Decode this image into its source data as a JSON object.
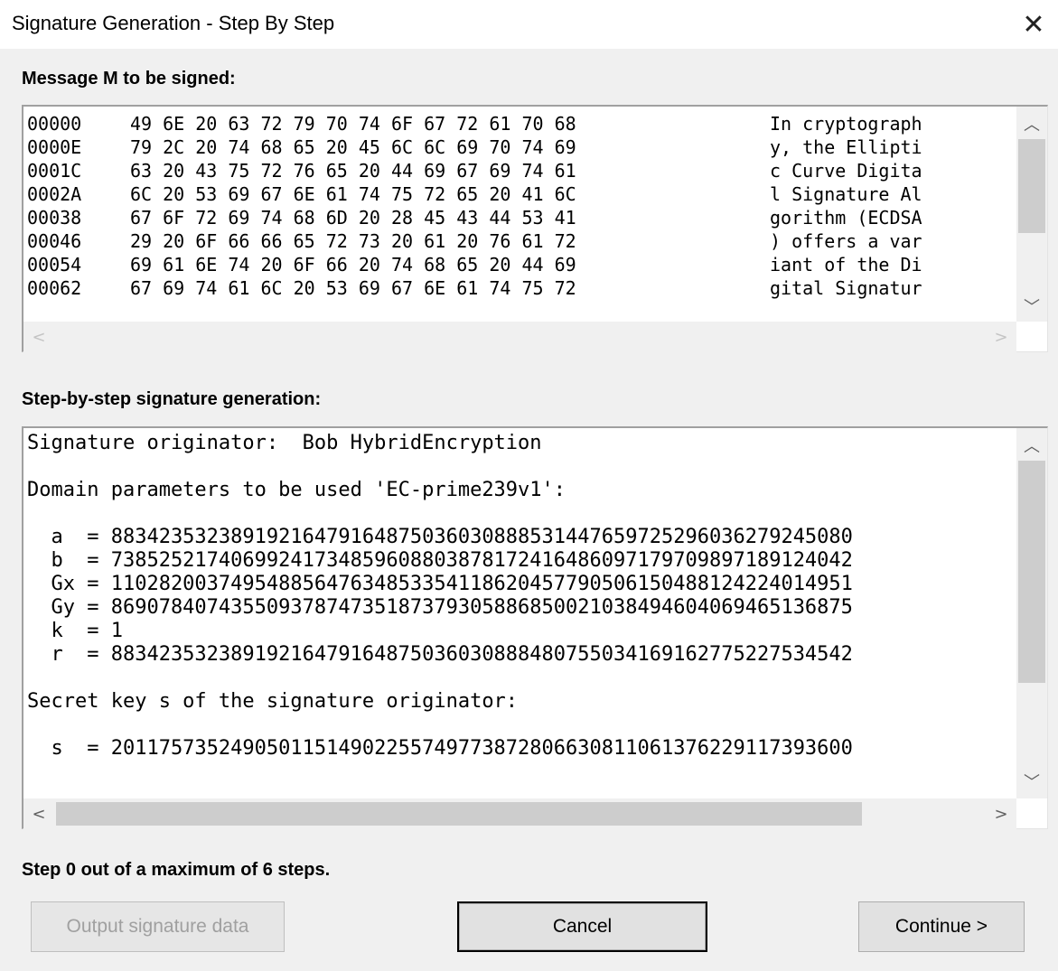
{
  "window": {
    "title": "Signature Generation - Step By Step",
    "close_icon": "close-icon"
  },
  "message_section": {
    "label": "Message M to be signed:",
    "rows": [
      {
        "offset": "00000",
        "hex": "49 6E 20 63 72 79 70 74 6F 67 72 61 70 68",
        "ascii": "In cryptograph"
      },
      {
        "offset": "0000E",
        "hex": "79 2C 20 74 68 65 20 45 6C 6C 69 70 74 69",
        "ascii": "y, the Ellipti"
      },
      {
        "offset": "0001C",
        "hex": "63 20 43 75 72 76 65 20 44 69 67 69 74 61",
        "ascii": "c Curve Digita"
      },
      {
        "offset": "0002A",
        "hex": "6C 20 53 69 67 6E 61 74 75 72 65 20 41 6C",
        "ascii": "l Signature Al"
      },
      {
        "offset": "00038",
        "hex": "67 6F 72 69 74 68 6D 20 28 45 43 44 53 41",
        "ascii": "gorithm (ECDSA"
      },
      {
        "offset": "00046",
        "hex": "29 20 6F 66 66 65 72 73 20 61 20 76 61 72",
        "ascii": ") offers a var"
      },
      {
        "offset": "00054",
        "hex": "69 61 6E 74 20 6F 66 20 74 68 65 20 44 69",
        "ascii": "iant of the Di"
      },
      {
        "offset": "00062",
        "hex": "67 69 74 61 6C 20 53 69 67 6E 61 74 75 72",
        "ascii": "gital Signatur"
      }
    ]
  },
  "steps_section": {
    "label": "Step-by-step signature generation:",
    "lines": [
      "Signature originator:  Bob HybridEncryption",
      "",
      "Domain parameters to be used 'EC-prime239v1':",
      "",
      "  a  = 88342353238919216479164875036030888531447659725296036279245080",
      "  b  = 73852521740699241734859608803878172416486097179709897189124042",
      "  Gx = 11028200374954885647634853354118620457790506150488124224014951",
      "  Gy = 86907840743550937874735187379305886850021038494604069465136875",
      "  k  = 1",
      "  r  = 88342353238919216479164875036030888480755034169162775227534542",
      "",
      "Secret key s of the signature originator:",
      "",
      "  s  = 20117573524905011514902255749773872806630811061376229117393600"
    ]
  },
  "status": {
    "text": "Step 0 out of a maximum of 6 steps."
  },
  "buttons": {
    "output": "Output signature data",
    "cancel": "Cancel",
    "continue": "Continue >"
  },
  "icons": {
    "up": "chevron-up-icon",
    "down": "chevron-down-icon",
    "left": "chevron-left-icon",
    "right": "chevron-right-icon"
  }
}
